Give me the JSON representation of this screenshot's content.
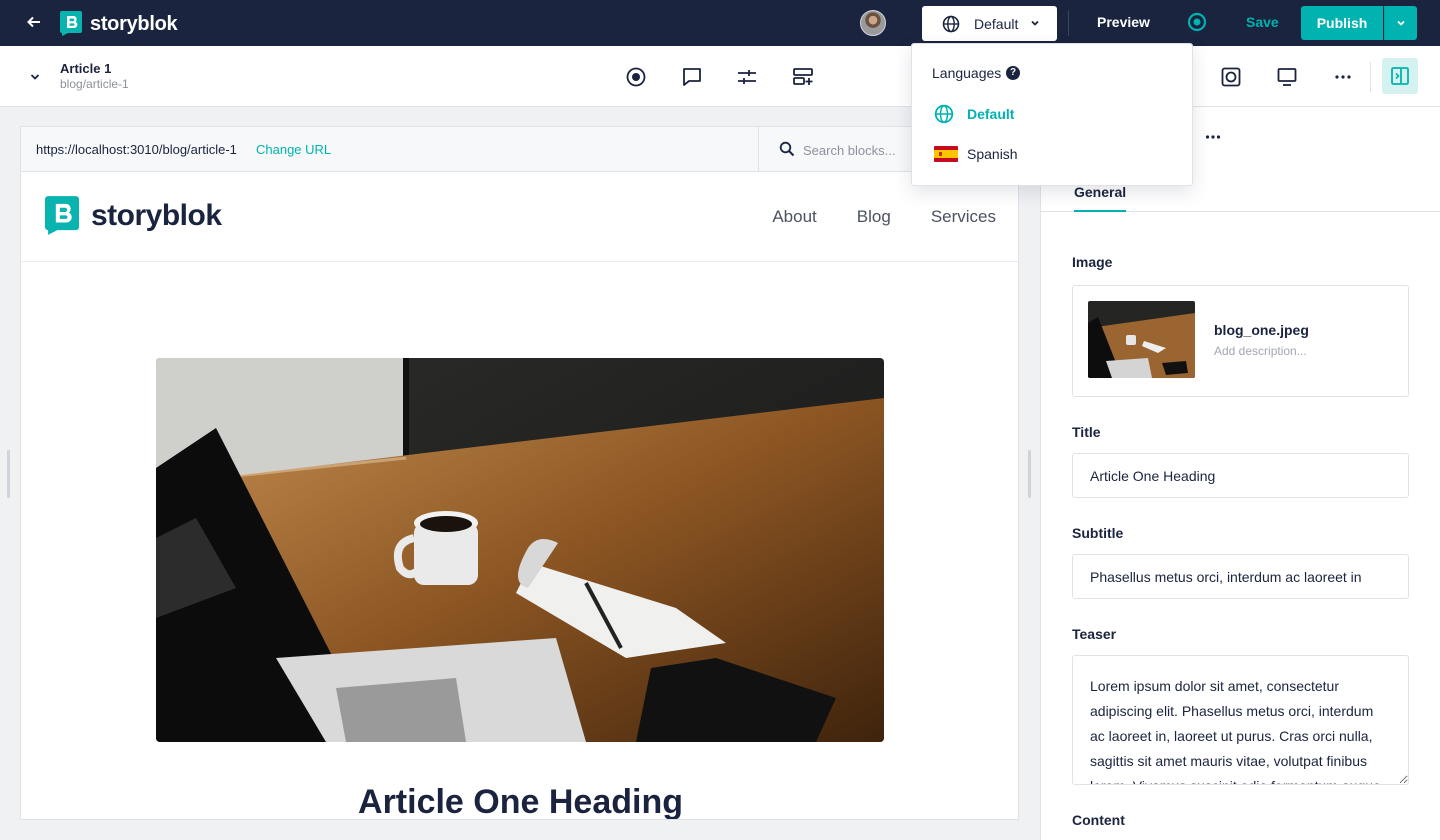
{
  "topbar": {
    "brand": "storyblok",
    "language_selected": "Default",
    "preview_label": "Preview",
    "save_label": "Save",
    "publish_label": "Publish"
  },
  "story": {
    "title": "Article 1",
    "slug": "blog/article-1"
  },
  "preview": {
    "url": "https://localhost:3010/blog/article-1",
    "change_url_label": "Change URL",
    "search_placeholder": "Search blocks...",
    "site_brand": "storyblok",
    "nav": [
      "About",
      "Blog",
      "Services"
    ],
    "heading": "Article One Heading"
  },
  "languages": {
    "title": "Languages",
    "help_glyph": "?",
    "items": [
      {
        "label": "Default",
        "icon": "globe-icon",
        "active": true
      },
      {
        "label": "Spanish",
        "icon": "spain-flag-icon",
        "active": false
      }
    ]
  },
  "panel": {
    "tab": "General",
    "image_label": "Image",
    "image_name": "blog_one.jpeg",
    "image_description": "Add description...",
    "title_label": "Title",
    "title_value": "Article One Heading",
    "subtitle_label": "Subtitle",
    "subtitle_value": "Phasellus metus orci, interdum ac laoreet in",
    "teaser_label": "Teaser",
    "teaser_value": "Lorem ipsum dolor sit amet, consectetur adipiscing elit. Phasellus metus orci, interdum ac laoreet in, laoreet ut purus. Cras orci nulla, sagittis sit amet mauris vitae, volutpat finibus lorem. Vivamus suscipit odio fermentum augue",
    "content_label": "Content"
  },
  "colors": {
    "navy": "#1b243f",
    "teal": "#00b3b0",
    "border": "#dfe3e8"
  }
}
